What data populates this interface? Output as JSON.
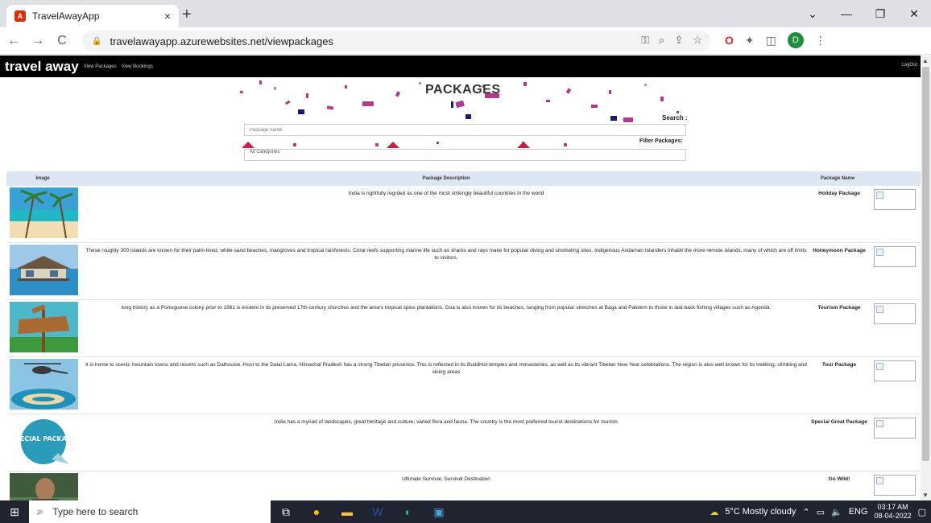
{
  "browser": {
    "tab_title": "TravelAwayApp",
    "tab_close": "×",
    "new_tab": "+",
    "url": "travelawayapp.azurewebsites.net/viewpackages",
    "back": "←",
    "forward": "→",
    "reload": "C",
    "minimize": "—",
    "maximize": "❐",
    "close": "✕",
    "chevron": "⌄",
    "avatar_letter": "D"
  },
  "site": {
    "brand": "travel away",
    "nav": [
      "View Packages",
      "View Bookings"
    ],
    "logout": "LogOut",
    "page_title": "PACKAGES",
    "search_label": "Search :",
    "search_placeholder": "Package name",
    "filter_label": "Filter Packages:",
    "filter_value": "All Categories"
  },
  "table": {
    "headers": {
      "image": "Image",
      "description": "Package Description",
      "name": "Package Name"
    },
    "rows": [
      {
        "description": "India is rightfully regrded as one of the most strikingly beautiful countries in the world",
        "name": "Holiday Package",
        "image": "beach-palm"
      },
      {
        "description": "These roughly 300 islands are known for their palm-lined, white-sand beaches, mangroves and tropical rainforests. Coral reefs supporting marine life such as sharks and rays make for popular diving and snorkeling sites. Indigenous Andaman Islanders inhabit the more remote islands, many of which are off limits to visitors.",
        "name": "Honeymoon Package",
        "image": "water-villa"
      },
      {
        "description": "long history as a Portuguese colony prior to 1961 is evident in its preserved 17th-century churches and the area's tropical spice plantations. Goa is also known for its beaches, ranging from popular stretches at Baga and Palolem to those in laid-back fishing villages such as Agonda.",
        "name": "Tourism Package",
        "image": "explore-sign"
      },
      {
        "description": "It is home to scenic mountain towns and resorts such as Dalhousie. Host to the Dalai Lama, Himachal Pradesh has a strong Tibetan presence. This is reflected in its Buddhist temples and monasteries, as well as its vibrant Tibetan New Year celebrations. The region is also well known for its trekking, climbing and skiing areas",
        "name": "Tour Package",
        "image": "helicopter-island"
      },
      {
        "description": "India has a myriad of landscapes, great heritage and culture, varied flora and fauna. The country is the most preferred tourist destinations for tourists",
        "name": "Special Great Package",
        "image": "special-sticker",
        "sticker_text": "SPECIAL PACKAGE"
      },
      {
        "description": "Ultimate Survival, Survival Destination",
        "name": "Go Wild!",
        "image": "survivor"
      }
    ]
  },
  "taskbar": {
    "search_placeholder": "Type here to search",
    "weather": "5°C  Mostly cloudy",
    "lang": "ENG",
    "time": "03:17 AM",
    "date": "08-04-2022"
  }
}
